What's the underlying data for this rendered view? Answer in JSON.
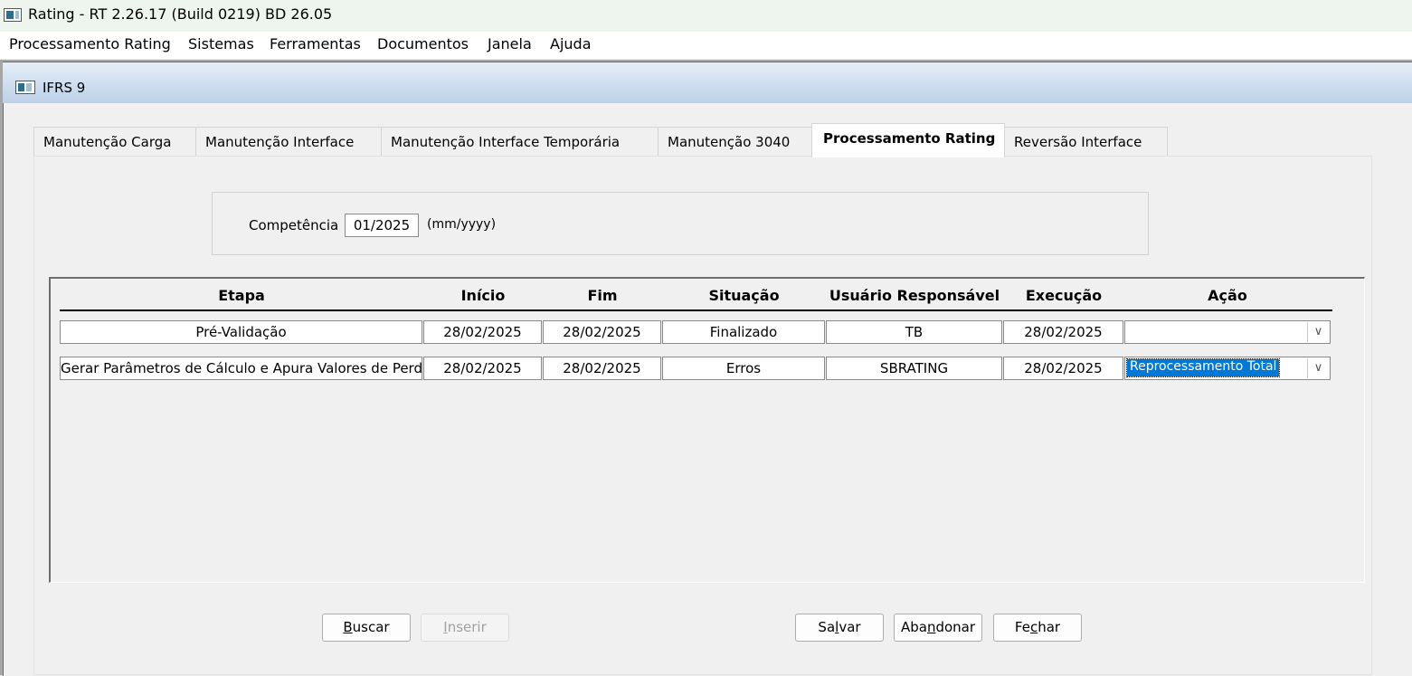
{
  "window": {
    "title": "Rating - RT 2.26.17 (Build 0219) BD 26.05"
  },
  "menubar": [
    "Processamento Rating",
    "Sistemas",
    "Ferramentas",
    "Documentos",
    "Janela",
    "Ajuda"
  ],
  "child_window": {
    "title": "IFRS 9"
  },
  "tabs": [
    "Manutenção Carga",
    "Manutenção Interface",
    "Manutenção Interface Temporária",
    "Manutenção 3040",
    "Processamento Rating",
    "Reversão Interface"
  ],
  "active_tab": "Processamento Rating",
  "competencia": {
    "label": "Competência",
    "value": "01/2025",
    "hint": "(mm/yyyy)"
  },
  "grid": {
    "columns": [
      "Etapa",
      "Início",
      "Fim",
      "Situação",
      "Usuário Responsável",
      "Execução",
      "Ação"
    ],
    "rows": [
      {
        "etapa": "Pré-Validação",
        "inicio": "28/02/2025",
        "fim": "28/02/2025",
        "situacao": "Finalizado",
        "usuario": "TB",
        "execucao": "28/02/2025",
        "acao": ""
      },
      {
        "etapa": "Gerar Parâmetros de Cálculo e Apura Valores de Perda",
        "inicio": "28/02/2025",
        "fim": "28/02/2025",
        "situacao": "Erros",
        "usuario": "SBRATING",
        "execucao": "28/02/2025",
        "acao": "Reprocessamento Total"
      }
    ]
  },
  "buttons": {
    "buscar": {
      "pre": "",
      "u": "B",
      "post": "uscar"
    },
    "inserir": {
      "pre": "",
      "u": "I",
      "post": "nserir"
    },
    "salvar": {
      "pre": "Sa",
      "u": "l",
      "post": "var"
    },
    "abandonar": {
      "pre": "Aba",
      "u": "n",
      "post": "donar"
    },
    "fechar": {
      "pre": "Fe",
      "u": "c",
      "post": "har"
    }
  },
  "colors": {
    "selection": "#0078d7",
    "window_bg": "#f0f0f0",
    "mdi_bg": "#a6a6a6"
  }
}
